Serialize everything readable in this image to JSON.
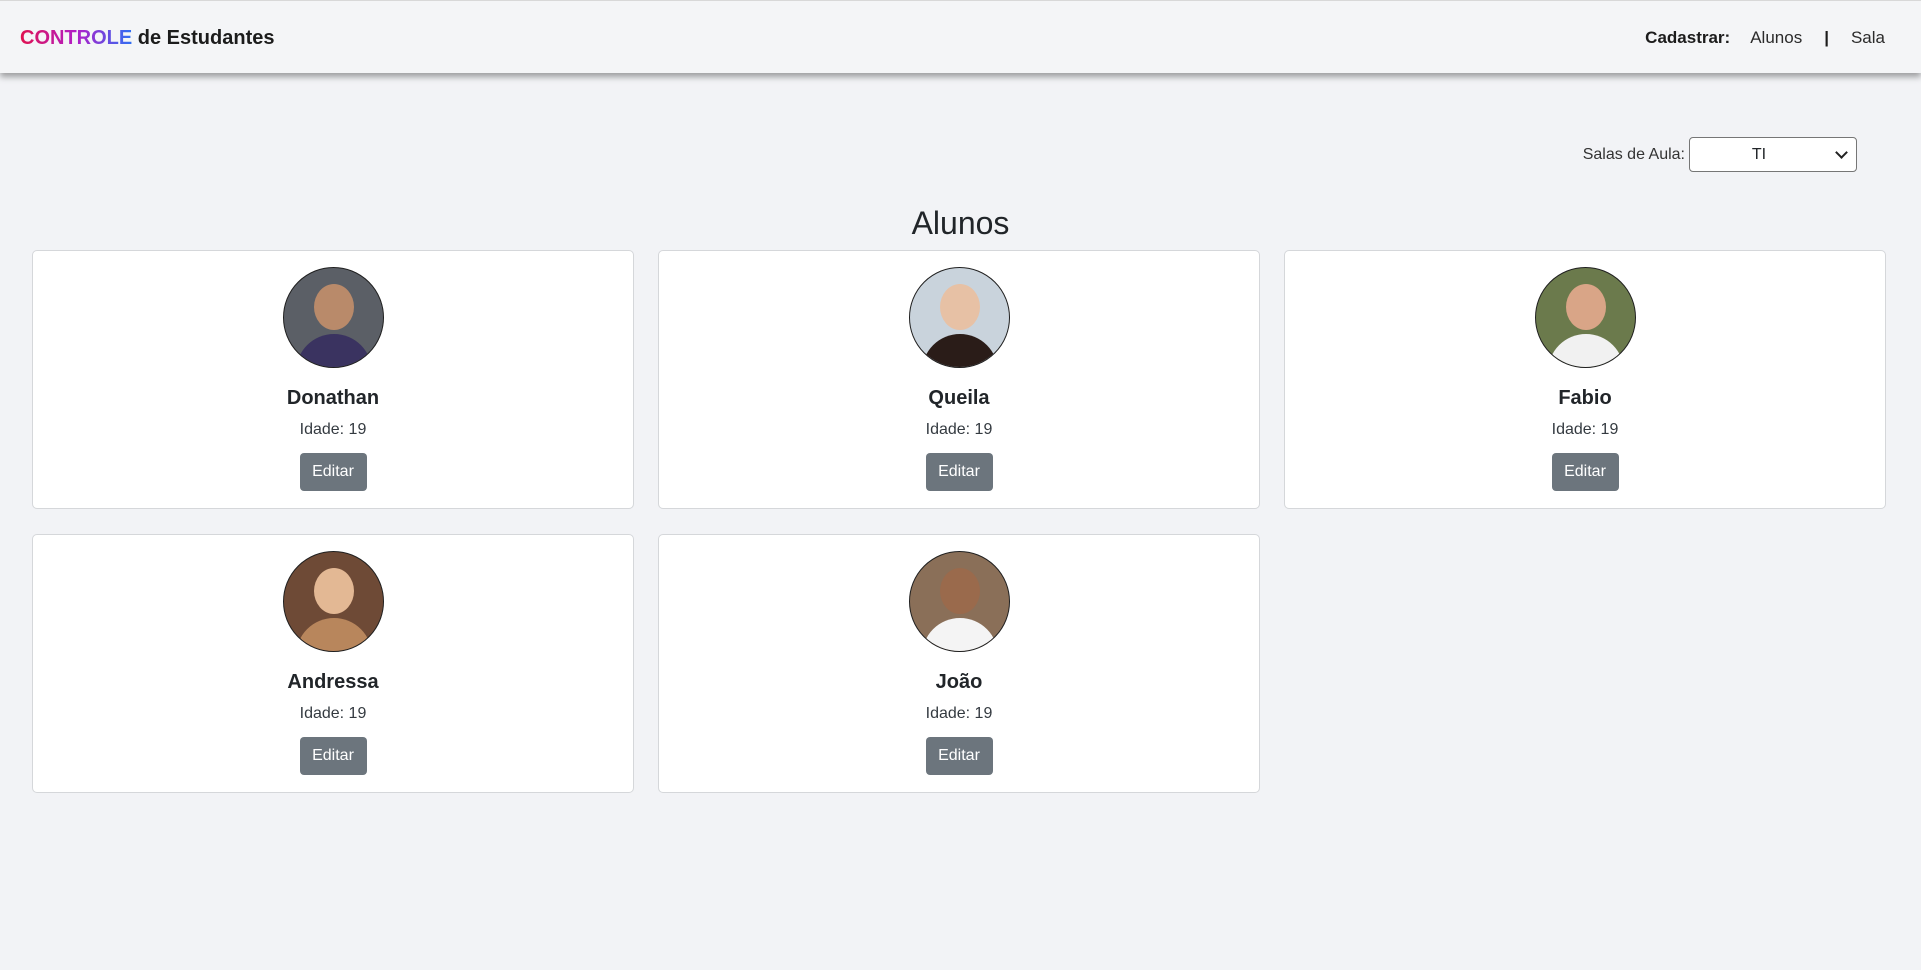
{
  "header": {
    "brand_accent": "CONTROLE",
    "brand_rest": "de Estudantes",
    "register_label": "Cadastrar:",
    "link_alunos": "Alunos",
    "separator": "|",
    "link_sala": "Sala"
  },
  "filter": {
    "label": "Salas de Aula:",
    "selected": "TI"
  },
  "main": {
    "title": "Alunos"
  },
  "students": [
    {
      "name": "Donathan",
      "age_label": "Idade: 19",
      "button": "Editar",
      "photo_bg": "#5b5f66",
      "skin": "#b98a6a",
      "shirt": "#3a3360"
    },
    {
      "name": "Queila",
      "age_label": "Idade: 19",
      "button": "Editar",
      "photo_bg": "#c9d3dc",
      "skin": "#e7c1a5",
      "shirt": "#2a1c18"
    },
    {
      "name": "Fabio",
      "age_label": "Idade: 19",
      "button": "Editar",
      "photo_bg": "#6b7a4c",
      "skin": "#d9a587",
      "shirt": "#f1f1f1"
    },
    {
      "name": "Andressa",
      "age_label": "Idade: 19",
      "button": "Editar",
      "photo_bg": "#6e4a36",
      "skin": "#e3b894",
      "shirt": "#b8865c"
    },
    {
      "name": "João",
      "age_label": "Idade: 19",
      "button": "Editar",
      "photo_bg": "#8a6f58",
      "skin": "#9a6a4c",
      "shirt": "#f4f4f4"
    }
  ]
}
